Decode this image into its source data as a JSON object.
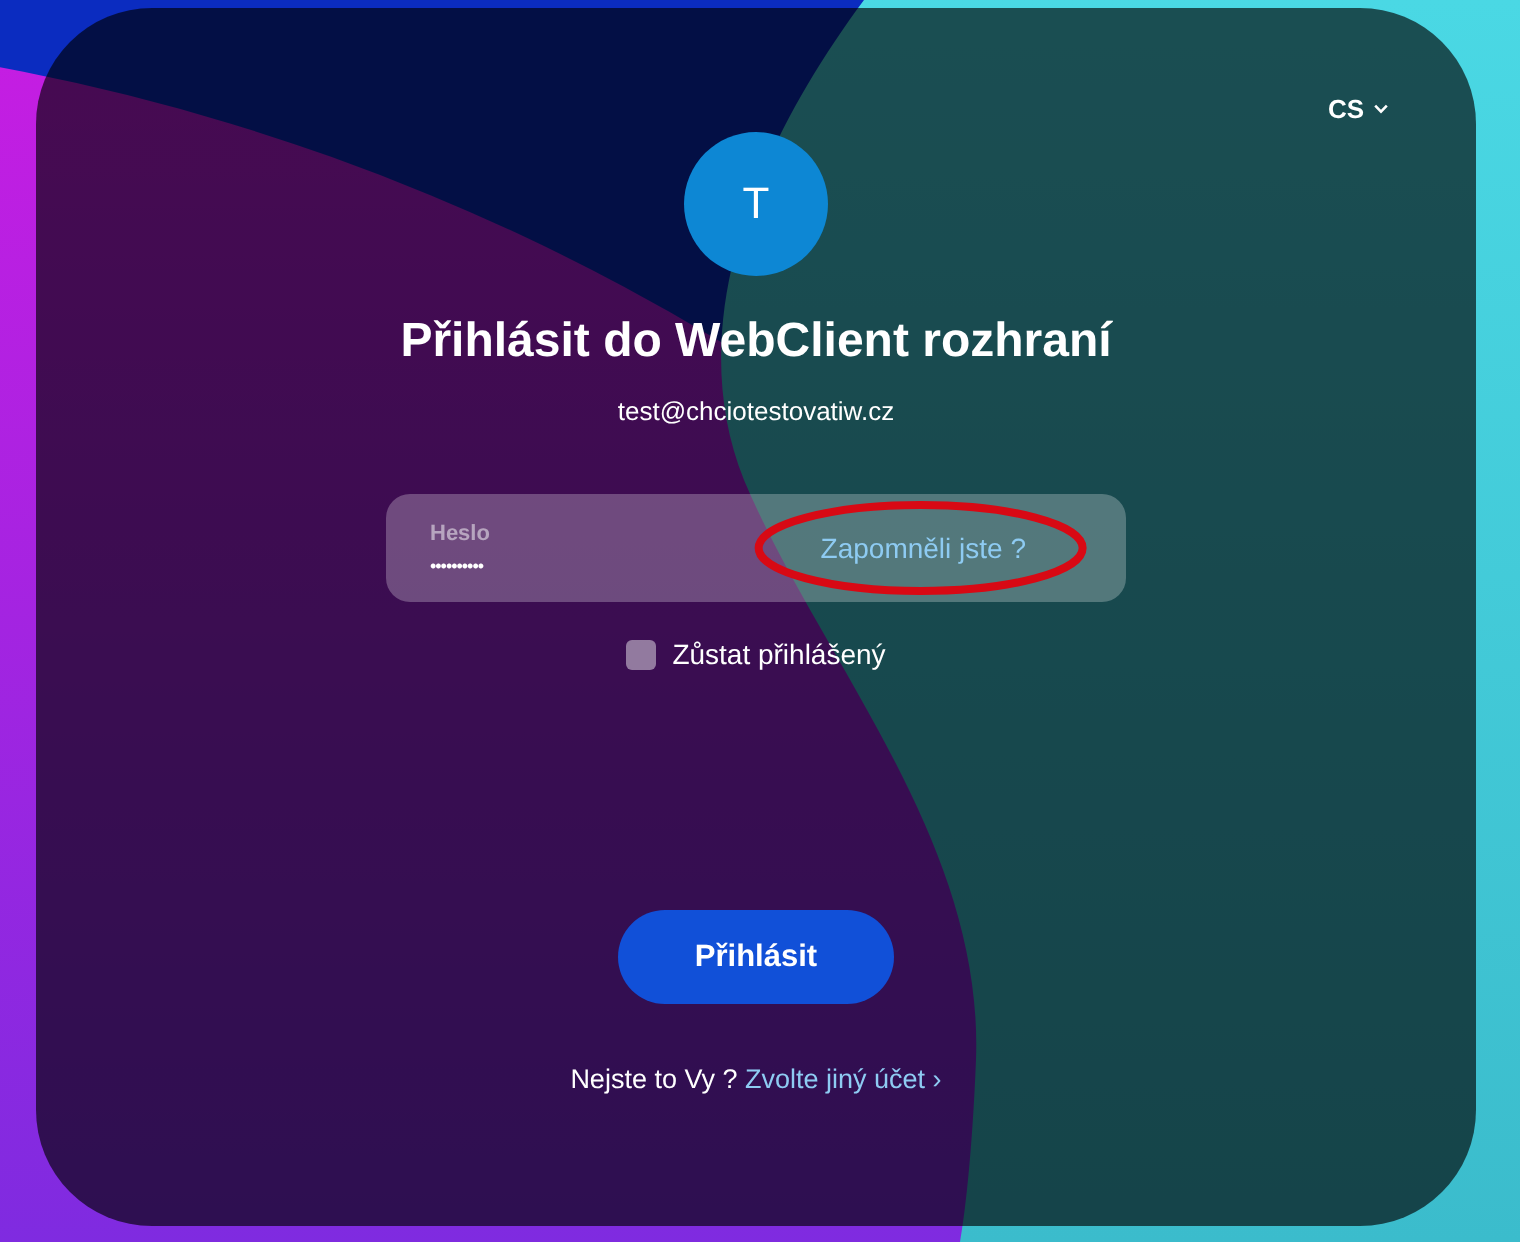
{
  "language_selector": {
    "label": "CS"
  },
  "avatar": {
    "initial": "T"
  },
  "title": "Přihlásit do WebClient rozhraní",
  "email": "test@chciotestovatiw.cz",
  "password_field": {
    "label": "Heslo",
    "value": "••••••••••"
  },
  "forgot_link": {
    "label": "Zapomněli jste ?",
    "circled": true
  },
  "remember_me": {
    "label": "Zůstat přihlášený",
    "checked": false
  },
  "submit_button": {
    "label": "Přihlásit"
  },
  "switch_account": {
    "text": "Nejste to Vy ?",
    "link": "Zvolte jiný účet ›"
  }
}
